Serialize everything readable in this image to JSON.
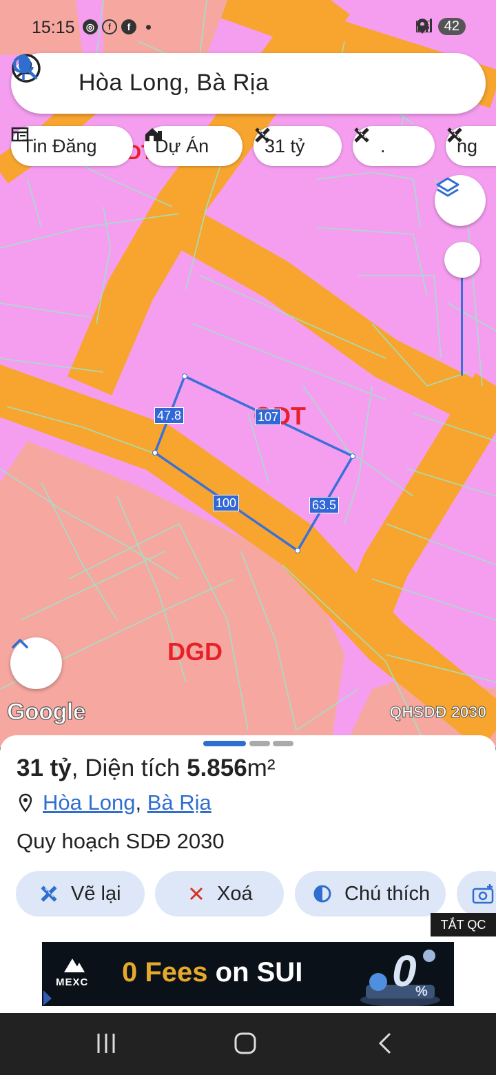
{
  "status_bar": {
    "time": "15:15",
    "battery": "42",
    "network": "5G"
  },
  "search": {
    "text": "Hòa Long, Bà Rịa"
  },
  "chips": [
    {
      "label": "Tin Đăng",
      "icon": "newspaper-icon"
    },
    {
      "label": "Dự Án",
      "icon": "house-icon"
    },
    {
      "label": "31 tỷ",
      "icon": "measure-icon"
    },
    {
      "label": ".",
      "icon": "measure-icon"
    },
    {
      "label": "ng",
      "icon": "measure-icon"
    }
  ],
  "map": {
    "measurements": [
      "47.8",
      "107",
      "100",
      "63.5"
    ],
    "zone_labels": [
      "ODT",
      "DGD",
      "ODT"
    ],
    "attribution": "Google",
    "layer_name": "QHSDĐ 2030",
    "colors": {
      "residential": "#f59ef0",
      "road": "#f7a52e",
      "public": "#f6a8a0",
      "parcel_line": "#9be6c9",
      "measure_line": "#3a70d8"
    }
  },
  "sheet": {
    "price": "31 tỷ",
    "area_prefix": ", Diện tích ",
    "area_value": "5.856",
    "area_unit": "m²",
    "location_ward": "Hòa Long",
    "location_sep": ",",
    "location_city": "Bà Rịa",
    "subtitle": "Quy hoạch SDĐ 2030",
    "actions": [
      {
        "label": "Vẽ lại",
        "icon": "measure-icon"
      },
      {
        "label": "Xoá",
        "icon": "close-icon"
      },
      {
        "label": "Chú thích",
        "icon": "contrast-icon"
      },
      {
        "label": "",
        "icon": "camera-icon"
      }
    ]
  },
  "ads": {
    "hide_label": "TẮT QC",
    "brand": "MEXC",
    "text_highlight": "0 Fees",
    "text_rest": " on SUI"
  }
}
